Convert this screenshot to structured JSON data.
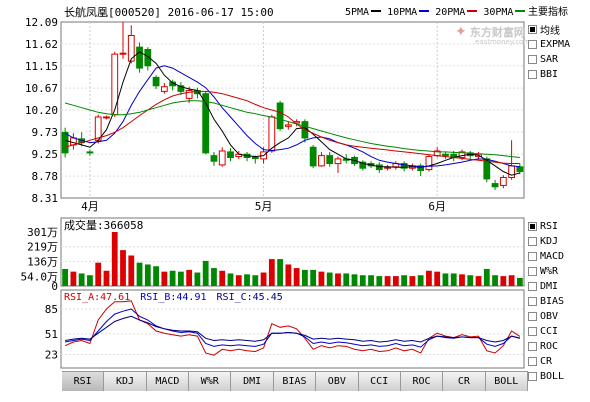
{
  "header": {
    "title": "长航凤凰[000520] 2016-06-17 15:00",
    "ma_legend": [
      {
        "label": "5PMA",
        "color": "#000000"
      },
      {
        "label": "10PMA",
        "color": "#0000cc"
      },
      {
        "label": "20PMA",
        "color": "#cc0000"
      },
      {
        "label": "30PMA",
        "color": "#008800"
      }
    ],
    "main_indicator_label": "主要指标"
  },
  "watermark": {
    "name": "东方财富网",
    "url": "eastmoney.com"
  },
  "main_indicator_options": [
    {
      "label": "均线",
      "checked": true
    },
    {
      "label": "EXPMA",
      "checked": false
    },
    {
      "label": "SAR",
      "checked": false
    },
    {
      "label": "BBI",
      "checked": false
    }
  ],
  "sub_indicator_options": [
    {
      "label": "RSI",
      "checked": true
    },
    {
      "label": "KDJ",
      "checked": false
    },
    {
      "label": "MACD",
      "checked": false
    },
    {
      "label": "W%R",
      "checked": false
    },
    {
      "label": "DMI",
      "checked": false
    },
    {
      "label": "BIAS",
      "checked": false
    },
    {
      "label": "OBV",
      "checked": false
    },
    {
      "label": "CCI",
      "checked": false
    },
    {
      "label": "ROC",
      "checked": false
    },
    {
      "label": "CR",
      "checked": false
    },
    {
      "label": "BOLL",
      "checked": false
    }
  ],
  "tabs": [
    "RSI",
    "KDJ",
    "MACD",
    "W%R",
    "DMI",
    "BIAS",
    "OBV",
    "CCI",
    "ROC",
    "CR",
    "BOLL"
  ],
  "active_tab": "RSI",
  "volume_label": "成交量:366058",
  "rsi_legend": [
    {
      "label": "RSI_A:47.61",
      "color": "#cc0000"
    },
    {
      "label": "RSI_B:44.91",
      "color": "#0000cc"
    },
    {
      "label": "RSI_C:45.45",
      "color": "#000080"
    }
  ],
  "chart_data": {
    "type": "candlestick",
    "y_ticks": [
      "12.09",
      "11.62",
      "11.15",
      "10.67",
      "10.20",
      "9.73",
      "9.25",
      "8.78",
      "8.31"
    ],
    "ylim": [
      8.31,
      12.09
    ],
    "month_labels": [
      {
        "label": "4月",
        "index": 3
      },
      {
        "label": "5月",
        "index": 24
      },
      {
        "label": "6月",
        "index": 45
      }
    ],
    "candles": [
      {
        "o": 9.72,
        "c": 9.28,
        "h": 9.82,
        "l": 9.18
      },
      {
        "o": 9.45,
        "c": 9.6,
        "h": 9.7,
        "l": 9.35
      },
      {
        "o": 9.58,
        "c": 9.5,
        "h": 9.72,
        "l": 9.42
      },
      {
        "o": 9.3,
        "c": 9.28,
        "h": 9.35,
        "l": 9.22
      },
      {
        "o": 9.55,
        "c": 10.05,
        "h": 10.1,
        "l": 9.48
      },
      {
        "o": 10.05,
        "c": 10.05,
        "h": 10.08,
        "l": 10.0
      },
      {
        "o": 10.1,
        "c": 11.4,
        "h": 11.45,
        "l": 10.05
      },
      {
        "o": 11.4,
        "c": 11.42,
        "h": 12.09,
        "l": 11.3
      },
      {
        "o": 11.25,
        "c": 11.8,
        "h": 12.02,
        "l": 11.2
      },
      {
        "o": 11.55,
        "c": 11.1,
        "h": 11.65,
        "l": 11.0
      },
      {
        "o": 11.5,
        "c": 11.15,
        "h": 11.55,
        "l": 11.05
      },
      {
        "o": 10.9,
        "c": 10.72,
        "h": 10.95,
        "l": 10.65
      },
      {
        "o": 10.6,
        "c": 10.7,
        "h": 10.78,
        "l": 10.55
      },
      {
        "o": 10.8,
        "c": 10.72,
        "h": 10.85,
        "l": 10.62
      },
      {
        "o": 10.72,
        "c": 10.6,
        "h": 10.8,
        "l": 10.52
      },
      {
        "o": 10.45,
        "c": 10.62,
        "h": 10.7,
        "l": 10.35
      },
      {
        "o": 10.62,
        "c": 10.55,
        "h": 10.68,
        "l": 10.45
      },
      {
        "o": 10.55,
        "c": 9.28,
        "h": 10.6,
        "l": 9.25
      },
      {
        "o": 9.22,
        "c": 9.1,
        "h": 9.3,
        "l": 9.0
      },
      {
        "o": 9.02,
        "c": 9.32,
        "h": 9.4,
        "l": 8.98
      },
      {
        "o": 9.3,
        "c": 9.18,
        "h": 9.38,
        "l": 9.1
      },
      {
        "o": 9.2,
        "c": 9.25,
        "h": 9.32,
        "l": 9.15
      },
      {
        "o": 9.25,
        "c": 9.18,
        "h": 9.3,
        "l": 9.1
      },
      {
        "o": 9.18,
        "c": 9.16,
        "h": 9.22,
        "l": 9.05
      },
      {
        "o": 9.15,
        "c": 9.3,
        "h": 9.4,
        "l": 9.05
      },
      {
        "o": 9.32,
        "c": 10.05,
        "h": 10.1,
        "l": 9.28
      },
      {
        "o": 10.35,
        "c": 9.8,
        "h": 10.4,
        "l": 9.75
      },
      {
        "o": 9.85,
        "c": 9.88,
        "h": 9.95,
        "l": 9.78
      },
      {
        "o": 9.92,
        "c": 9.95,
        "h": 10.0,
        "l": 9.85
      },
      {
        "o": 9.95,
        "c": 9.6,
        "h": 10.0,
        "l": 9.5
      },
      {
        "o": 9.4,
        "c": 9.0,
        "h": 9.45,
        "l": 8.95
      },
      {
        "o": 9.0,
        "c": 9.22,
        "h": 9.3,
        "l": 8.98
      },
      {
        "o": 9.22,
        "c": 9.05,
        "h": 9.3,
        "l": 8.98
      },
      {
        "o": 9.05,
        "c": 9.15,
        "h": 9.2,
        "l": 8.85
      },
      {
        "o": 9.15,
        "c": 9.12,
        "h": 9.25,
        "l": 9.05
      },
      {
        "o": 9.18,
        "c": 9.05,
        "h": 9.22,
        "l": 9.0
      },
      {
        "o": 9.08,
        "c": 8.95,
        "h": 9.12,
        "l": 8.9
      },
      {
        "o": 9.05,
        "c": 9.0,
        "h": 9.1,
        "l": 8.95
      },
      {
        "o": 9.02,
        "c": 8.92,
        "h": 9.08,
        "l": 8.85
      },
      {
        "o": 8.95,
        "c": 8.97,
        "h": 9.02,
        "l": 8.9
      },
      {
        "o": 8.98,
        "c": 9.05,
        "h": 9.1,
        "l": 8.92
      },
      {
        "o": 9.05,
        "c": 8.95,
        "h": 9.1,
        "l": 8.88
      },
      {
        "o": 8.95,
        "c": 9.0,
        "h": 9.05,
        "l": 8.9
      },
      {
        "o": 9.0,
        "c": 8.9,
        "h": 9.05,
        "l": 8.78
      },
      {
        "o": 8.92,
        "c": 9.2,
        "h": 9.25,
        "l": 8.88
      },
      {
        "o": 9.22,
        "c": 9.32,
        "h": 9.4,
        "l": 9.18
      },
      {
        "o": 9.25,
        "c": 9.22,
        "h": 9.3,
        "l": 9.15
      },
      {
        "o": 9.25,
        "c": 9.18,
        "h": 9.32,
        "l": 9.1
      },
      {
        "o": 9.18,
        "c": 9.3,
        "h": 9.35,
        "l": 9.12
      },
      {
        "o": 9.28,
        "c": 9.22,
        "h": 9.32,
        "l": 9.15
      },
      {
        "o": 9.2,
        "c": 9.25,
        "h": 9.3,
        "l": 9.15
      },
      {
        "o": 9.15,
        "c": 8.72,
        "h": 9.2,
        "l": 8.65
      },
      {
        "o": 8.62,
        "c": 8.55,
        "h": 8.7,
        "l": 8.48
      },
      {
        "o": 8.58,
        "c": 8.75,
        "h": 8.8,
        "l": 8.52
      },
      {
        "o": 8.75,
        "c": 9.0,
        "h": 9.55,
        "l": 8.7
      },
      {
        "o": 8.98,
        "c": 8.88,
        "h": 9.05,
        "l": 8.82
      }
    ],
    "ma5": [
      9.55,
      9.5,
      9.45,
      9.4,
      9.55,
      9.78,
      10.2,
      10.8,
      11.3,
      11.45,
      11.35,
      11.2,
      10.95,
      10.78,
      10.7,
      10.65,
      10.62,
      10.35,
      10.0,
      9.75,
      9.45,
      9.25,
      9.22,
      9.2,
      9.22,
      9.38,
      9.5,
      9.6,
      9.8,
      9.82,
      9.68,
      9.52,
      9.35,
      9.25,
      9.15,
      9.12,
      9.05,
      9.02,
      8.98,
      8.98,
      8.97,
      8.97,
      8.98,
      8.97,
      9.0,
      9.05,
      9.12,
      9.18,
      9.22,
      9.25,
      9.23,
      9.12,
      9.0,
      8.88,
      8.8,
      8.85
    ],
    "ma10": [
      9.7,
      9.6,
      9.55,
      9.5,
      9.52,
      9.55,
      9.7,
      9.95,
      10.3,
      10.6,
      10.85,
      11.1,
      11.15,
      11.1,
      11.0,
      10.9,
      10.8,
      10.68,
      10.48,
      10.25,
      10.05,
      9.85,
      9.65,
      9.48,
      9.35,
      9.33,
      9.35,
      9.38,
      9.45,
      9.55,
      9.6,
      9.62,
      9.58,
      9.5,
      9.45,
      9.38,
      9.3,
      9.2,
      9.12,
      9.08,
      9.05,
      9.02,
      9.0,
      8.98,
      8.99,
      9.0,
      9.02,
      9.05,
      9.08,
      9.12,
      9.15,
      9.14,
      9.1,
      9.05,
      9.0,
      8.98
    ],
    "ma20": [
      9.4,
      9.45,
      9.5,
      9.55,
      9.6,
      9.65,
      9.72,
      9.82,
      9.95,
      10.08,
      10.2,
      10.32,
      10.42,
      10.5,
      10.55,
      10.58,
      10.6,
      10.6,
      10.58,
      10.55,
      10.5,
      10.45,
      10.4,
      10.32,
      10.25,
      10.2,
      10.15,
      10.05,
      9.9,
      9.78,
      9.7,
      9.62,
      9.55,
      9.5,
      9.45,
      9.42,
      9.4,
      9.38,
      9.36,
      9.34,
      9.32,
      9.3,
      9.28,
      9.26,
      9.24,
      9.22,
      9.2,
      9.18,
      9.16,
      9.14,
      9.12,
      9.1,
      9.08,
      9.06,
      9.05,
      9.05
    ],
    "ma30": [
      10.35,
      10.3,
      10.25,
      10.2,
      10.15,
      10.12,
      10.1,
      10.1,
      10.12,
      10.15,
      10.2,
      10.25,
      10.3,
      10.35,
      10.38,
      10.4,
      10.4,
      10.38,
      10.35,
      10.3,
      10.25,
      10.2,
      10.15,
      10.12,
      10.08,
      10.05,
      10.0,
      9.95,
      9.9,
      9.85,
      9.8,
      9.75,
      9.7,
      9.65,
      9.6,
      9.56,
      9.52,
      9.48,
      9.45,
      9.42,
      9.4,
      9.37,
      9.35,
      9.33,
      9.32,
      9.3,
      9.3,
      9.29,
      9.28,
      9.27,
      9.26,
      9.25,
      9.24,
      9.22,
      9.2,
      9.18
    ],
    "volume_ticks": [
      "301万",
      "219万",
      "136万",
      "54.0万",
      "0"
    ],
    "volume_ticks_values": [
      301,
      219,
      136,
      54,
      0
    ],
    "volume": [
      95,
      80,
      70,
      60,
      130,
      85,
      301,
      200,
      170,
      130,
      120,
      110,
      80,
      85,
      80,
      90,
      75,
      140,
      100,
      85,
      70,
      60,
      65,
      60,
      75,
      150,
      150,
      120,
      100,
      90,
      90,
      80,
      75,
      70,
      70,
      65,
      60,
      60,
      55,
      55,
      55,
      60,
      55,
      60,
      85,
      80,
      70,
      70,
      65,
      60,
      55,
      95,
      60,
      55,
      60,
      45
    ],
    "rsi_ticks": [
      "85",
      "51",
      "23"
    ],
    "rsi_ticks_values": [
      85,
      51,
      23
    ],
    "rsi_a": [
      35,
      40,
      42,
      38,
      70,
      85,
      95,
      95,
      96,
      70,
      65,
      55,
      52,
      50,
      48,
      50,
      48,
      25,
      22,
      30,
      28,
      30,
      28,
      27,
      32,
      65,
      60,
      62,
      58,
      45,
      30,
      35,
      32,
      35,
      34,
      30,
      28,
      30,
      27,
      28,
      32,
      28,
      30,
      25,
      45,
      52,
      48,
      46,
      50,
      47,
      48,
      28,
      25,
      35,
      55,
      47.61
    ],
    "rsi_b": [
      40,
      42,
      44,
      42,
      55,
      68,
      78,
      82,
      85,
      75,
      70,
      62,
      58,
      55,
      53,
      54,
      52,
      38,
      34,
      36,
      35,
      36,
      35,
      34,
      37,
      52,
      52,
      53,
      52,
      47,
      38,
      40,
      38,
      40,
      39,
      37,
      35,
      36,
      34,
      35,
      38,
      35,
      36,
      33,
      43,
      48,
      46,
      45,
      47,
      46,
      46,
      37,
      34,
      38,
      48,
      44.91
    ],
    "rsi_c": [
      42,
      44,
      45,
      44,
      52,
      60,
      68,
      72,
      75,
      70,
      66,
      61,
      58,
      56,
      55,
      55,
      54,
      45,
      42,
      43,
      42,
      43,
      42,
      41,
      43,
      52,
      52,
      53,
      52,
      49,
      44,
      45,
      44,
      45,
      44,
      43,
      41,
      42,
      40,
      41,
      43,
      41,
      42,
      40,
      45,
      48,
      47,
      46,
      47,
      46,
      46,
      42,
      40,
      42,
      48,
      45.45
    ]
  }
}
